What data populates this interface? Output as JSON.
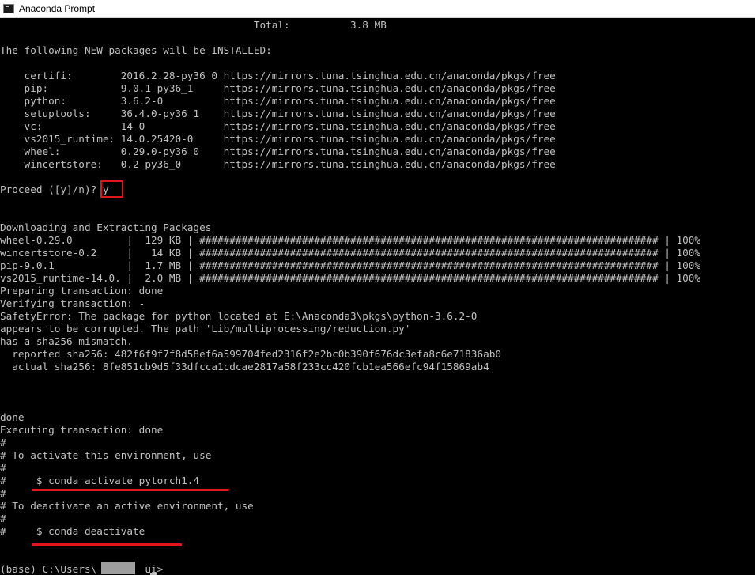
{
  "window": {
    "title": "Anaconda Prompt",
    "icon": "terminal-icon"
  },
  "console": {
    "lines": [
      "                                          Total:          3.8 MB",
      "",
      "The following NEW packages will be INSTALLED:",
      "",
      "    certifi:        2016.2.28-py36_0 https://mirrors.tuna.tsinghua.edu.cn/anaconda/pkgs/free",
      "    pip:            9.0.1-py36_1     https://mirrors.tuna.tsinghua.edu.cn/anaconda/pkgs/free",
      "    python:         3.6.2-0          https://mirrors.tuna.tsinghua.edu.cn/anaconda/pkgs/free",
      "    setuptools:     36.4.0-py36_1    https://mirrors.tuna.tsinghua.edu.cn/anaconda/pkgs/free",
      "    vc:             14-0             https://mirrors.tuna.tsinghua.edu.cn/anaconda/pkgs/free",
      "    vs2015_runtime: 14.0.25420-0     https://mirrors.tuna.tsinghua.edu.cn/anaconda/pkgs/free",
      "    wheel:          0.29.0-py36_0    https://mirrors.tuna.tsinghua.edu.cn/anaconda/pkgs/free",
      "    wincertstore:   0.2-py36_0       https://mirrors.tuna.tsinghua.edu.cn/anaconda/pkgs/free",
      "",
      "Proceed ([y]/n)? y",
      "",
      "",
      "Downloading and Extracting Packages",
      "wheel-0.29.0         |  129 KB | ############################################################################ | 100%",
      "wincertstore-0.2     |   14 KB | ############################################################################ | 100%",
      "pip-9.0.1            |  1.7 MB | ############################################################################ | 100%",
      "vs2015_runtime-14.0. |  2.0 MB | ############################################################################ | 100%",
      "Preparing transaction: done",
      "Verifying transaction: -",
      "SafetyError: The package for python located at E:\\Anaconda3\\pkgs\\python-3.6.2-0",
      "appears to be corrupted. The path 'Lib/multiprocessing/reduction.py'",
      "has a sha256 mismatch.",
      "  reported sha256: 482f6f9f7f8d58ef6a599704fed2316f2e2bc0b390f676dc3efa8c6e71836ab0",
      "  actual sha256: 8fe851cb9d5f33dfcca1cdcae2817a58f233cc420fcb1ea566efc94f15869ab4",
      "",
      "",
      "",
      "done",
      "Executing transaction: done",
      "#",
      "# To activate this environment, use",
      "#",
      "#     $ conda activate pytorch1.4",
      "#",
      "# To deactivate an active environment, use",
      "#",
      "#     $ conda deactivate",
      "",
      "",
      "(base) C:\\Users\\        ui>"
    ]
  },
  "colors": {
    "console_bg": "#000000",
    "console_fg": "#c0c0c0",
    "annotation_red": "#e0161b",
    "redaction_gray": "#9e9e9e"
  }
}
